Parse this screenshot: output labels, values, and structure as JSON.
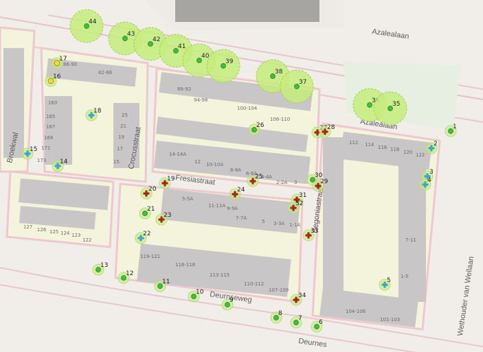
{
  "map": {
    "streets": {
      "azalealaan_top": "Azalealaan",
      "azalealaan_mid": "Azalealaan",
      "broekwal": "Broekwal",
      "crocusstraat": "Crocusstraat",
      "fresiastraat": "Fresiastraat",
      "begoniastraat": "Begoniastraat",
      "deurnseweg": "Deurnseweg",
      "deurnese_bottom": "Deurnes",
      "wethouder": "Wethouder van Wellaan"
    },
    "house_numbers": {
      "a": "86-90",
      "b": "82-86",
      "c": "88-92",
      "d": "94-98",
      "e": "100-104",
      "f": "106-110",
      "g": "163",
      "h": "165",
      "i": "167",
      "j": "169",
      "k": "171",
      "l": "173",
      "m": "25",
      "n": "21",
      "o": "19",
      "p": "17",
      "q": "15",
      "r": "14-14A",
      "s": "12",
      "t": "10-10A",
      "u": "8-8A",
      "v": "6-6A",
      "w": "4-4A",
      "x": "2-2A",
      "y": "3",
      "z": "5-5A",
      "aa": "11-11A",
      "ab": "9-9A",
      "ac": "7-7A",
      "ad": "5",
      "ae": "3-3A",
      "af": "1-1A",
      "ag": "127",
      "ah": "126",
      "ai": "125",
      "aj": "124",
      "ak": "123",
      "al": "122",
      "am": "119-121",
      "an": "116-118",
      "ao": "113-115",
      "ap": "110-112",
      "aq": "107-109",
      "ar": "112",
      "as": "114",
      "at": "116",
      "au": "118",
      "av": "120",
      "aw": "122",
      "ax": "7-11",
      "ay": "1-5",
      "az": "104-106",
      "ba": "101-103"
    },
    "markers": [
      {
        "id": "44",
        "kind": "tree",
        "size": "large"
      },
      {
        "id": "43",
        "kind": "tree",
        "size": "large"
      },
      {
        "id": "42",
        "kind": "tree",
        "size": "large"
      },
      {
        "id": "41",
        "kind": "tree",
        "size": "large"
      },
      {
        "id": "40",
        "kind": "tree",
        "size": "large"
      },
      {
        "id": "39",
        "kind": "tree",
        "size": "large"
      },
      {
        "id": "38",
        "kind": "tree",
        "size": "large"
      },
      {
        "id": "37",
        "kind": "tree",
        "size": "large"
      },
      {
        "id": "36",
        "kind": "tree",
        "size": "large"
      },
      {
        "id": "35",
        "kind": "tree",
        "size": "large"
      },
      {
        "id": "17",
        "kind": "yellow",
        "size": "small"
      },
      {
        "id": "16",
        "kind": "yellow",
        "size": "small"
      },
      {
        "id": "18",
        "kind": "cross-blue",
        "size": "small"
      },
      {
        "id": "15",
        "kind": "cross-blue",
        "size": "small"
      },
      {
        "id": "14",
        "kind": "cross-blue",
        "size": "small"
      },
      {
        "id": "26",
        "kind": "tree",
        "size": "small"
      },
      {
        "id": "27",
        "kind": "cross-red",
        "size": "small"
      },
      {
        "id": "28",
        "kind": "cross-red",
        "size": "small"
      },
      {
        "id": "1",
        "kind": "tree",
        "size": "small"
      },
      {
        "id": "2",
        "kind": "cross-blue",
        "size": "small"
      },
      {
        "id": "3",
        "kind": "cross-blue",
        "size": "small"
      },
      {
        "id": "4",
        "kind": "cross-blue",
        "size": "small"
      },
      {
        "id": "19",
        "kind": "cross-red",
        "size": "small"
      },
      {
        "id": "20",
        "kind": "cross-red",
        "size": "small"
      },
      {
        "id": "25",
        "kind": "cross-red",
        "size": "small"
      },
      {
        "id": "24",
        "kind": "cross-red",
        "size": "small"
      },
      {
        "id": "30",
        "kind": "tree",
        "size": "small"
      },
      {
        "id": "29",
        "kind": "cross-red",
        "size": "small"
      },
      {
        "id": "31",
        "kind": "cross-red",
        "size": "small"
      },
      {
        "id": "32",
        "kind": "cross-red",
        "size": "small"
      },
      {
        "id": "21",
        "kind": "tree",
        "size": "small"
      },
      {
        "id": "23",
        "kind": "cross-red",
        "size": "small"
      },
      {
        "id": "22",
        "kind": "cross-blue",
        "size": "small"
      },
      {
        "id": "33",
        "kind": "cross-red",
        "size": "small"
      },
      {
        "id": "13",
        "kind": "tree",
        "size": "small"
      },
      {
        "id": "12",
        "kind": "tree",
        "size": "small"
      },
      {
        "id": "11",
        "kind": "tree",
        "size": "small"
      },
      {
        "id": "10",
        "kind": "tree",
        "size": "small"
      },
      {
        "id": "9",
        "kind": "tree",
        "size": "small"
      },
      {
        "id": "34",
        "kind": "cross-red",
        "size": "small"
      },
      {
        "id": "8",
        "kind": "tree",
        "size": "small"
      },
      {
        "id": "7",
        "kind": "tree",
        "size": "small"
      },
      {
        "id": "6",
        "kind": "tree",
        "size": "small"
      },
      {
        "id": "5",
        "kind": "cross-blue",
        "size": "small"
      }
    ],
    "colors": {
      "ground": "#f1eee9",
      "block": "#f4f3dc",
      "block_outline": "#ecc8d0",
      "building": "#c8c6c6",
      "road_outline": "#e7c7cf",
      "canopy": "#c5ec7a",
      "tree_dot": "#3fbf3f",
      "yellow_dot": "#eadd3c",
      "cross_blue": "#3aa6c8",
      "cross_red": "#a8231c",
      "dark_block": "#3f3f3f"
    }
  }
}
